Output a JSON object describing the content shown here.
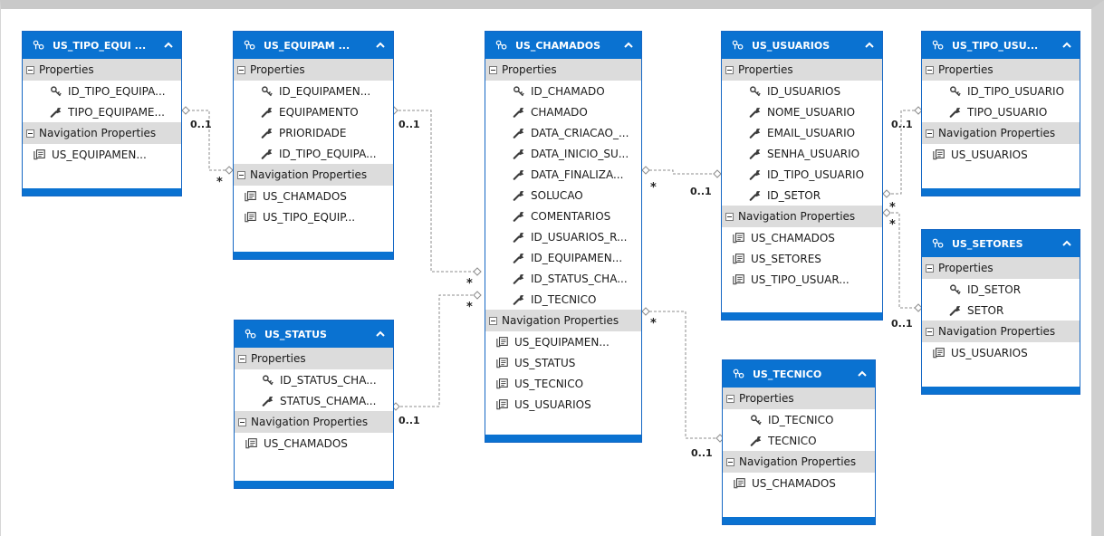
{
  "entities": {
    "tipo_equip": {
      "title": "US_TIPO_EQUI ...",
      "properties_label": "Properties",
      "navigation_label": "Navigation Properties",
      "properties": [
        "ID_TIPO_EQUIPA...",
        "TIPO_EQUIPAME..."
      ],
      "navigation": [
        "US_EQUIPAMEN..."
      ]
    },
    "equipamento": {
      "title": "US_EQUIPAM ...",
      "properties_label": "Properties",
      "navigation_label": "Navigation Properties",
      "properties": [
        "ID_EQUIPAMEN...",
        "EQUIPAMENTO",
        "PRIORIDADE",
        "ID_TIPO_EQUIPA..."
      ],
      "navigation": [
        "US_CHAMADOS",
        "US_TIPO_EQUIP..."
      ]
    },
    "chamados": {
      "title": "US_CHAMADOS",
      "properties_label": "Properties",
      "navigation_label": "Navigation Properties",
      "properties": [
        "ID_CHAMADO",
        "CHAMADO",
        "DATA_CRIACAO_...",
        "DATA_INICIO_SU...",
        "DATA_FINALIZA...",
        "SOLUCAO",
        "COMENTARIOS",
        "ID_USUARIOS_R...",
        "ID_EQUIPAMEN...",
        "ID_STATUS_CHA...",
        "ID_TECNICO"
      ],
      "navigation": [
        "US_EQUIPAMEN...",
        "US_STATUS",
        "US_TECNICO",
        "US_USUARIOS"
      ]
    },
    "usuarios": {
      "title": "US_USUARIOS",
      "properties_label": "Properties",
      "navigation_label": "Navigation Properties",
      "properties": [
        "ID_USUARIOS",
        "NOME_USUARIO",
        "EMAIL_USUARIO",
        "SENHA_USUARIO",
        "ID_TIPO_USUARIO",
        "ID_SETOR"
      ],
      "navigation": [
        "US_CHAMADOS",
        "US_SETORES",
        "US_TIPO_USUAR..."
      ]
    },
    "tipo_usuario": {
      "title": "US_TIPO_USU...",
      "properties_label": "Properties",
      "navigation_label": "Navigation Properties",
      "properties": [
        "ID_TIPO_USUARIO",
        "TIPO_USUARIO"
      ],
      "navigation": [
        "US_USUARIOS"
      ]
    },
    "setores": {
      "title": "US_SETORES",
      "properties_label": "Properties",
      "navigation_label": "Navigation Properties",
      "properties": [
        "ID_SETOR",
        "SETOR"
      ],
      "navigation": [
        "US_USUARIOS"
      ]
    },
    "status": {
      "title": "US_STATUS",
      "properties_label": "Properties",
      "navigation_label": "Navigation Properties",
      "properties": [
        "ID_STATUS_CHA...",
        "STATUS_CHAMA..."
      ],
      "navigation": [
        "US_CHAMADOS"
      ]
    },
    "tecnico": {
      "title": "US_TECNICO",
      "properties_label": "Properties",
      "navigation_label": "Navigation Properties",
      "properties": [
        "ID_TECNICO",
        "TECNICO"
      ],
      "navigation": [
        "US_CHAMADOS"
      ]
    }
  },
  "multiplicities": {
    "one": "0..1",
    "many": "*"
  },
  "icons": {
    "header": "entity-type-icon",
    "key": "key-icon",
    "property": "wrench-icon",
    "navigation": "navigation-property-icon",
    "collapse": "chevron-up-icon",
    "section_toggle": "collapse-minus-icon"
  },
  "colors": {
    "header": "#0a72d1",
    "section": "#dcdcdc",
    "connector": "#8c8c8c"
  }
}
